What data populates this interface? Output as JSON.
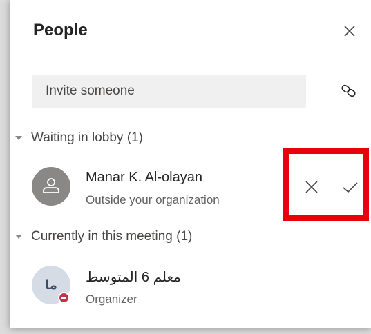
{
  "panel": {
    "title": "People",
    "close_icon": "close-icon"
  },
  "invite": {
    "placeholder": "Invite someone",
    "link_icon": "link-icon"
  },
  "lobby": {
    "header": "Waiting in lobby (1)",
    "person": {
      "name": "Manar K. Al-olayan",
      "subtitle": "Outside your organization",
      "avatar_icon": "person-icon",
      "deny_icon": "deny-icon",
      "admit_icon": "admit-checkmark-icon"
    }
  },
  "meeting": {
    "header": "Currently in this meeting (1)",
    "person": {
      "name": "معلم 6 المتوسط",
      "initials": "ما",
      "subtitle": "Organizer",
      "presence": "do-not-disturb",
      "presence_color": "#c4314b"
    }
  },
  "colors": {
    "highlight": "#e8000b",
    "panel_bg": "#ffffff",
    "input_bg": "#f0f0f0"
  }
}
